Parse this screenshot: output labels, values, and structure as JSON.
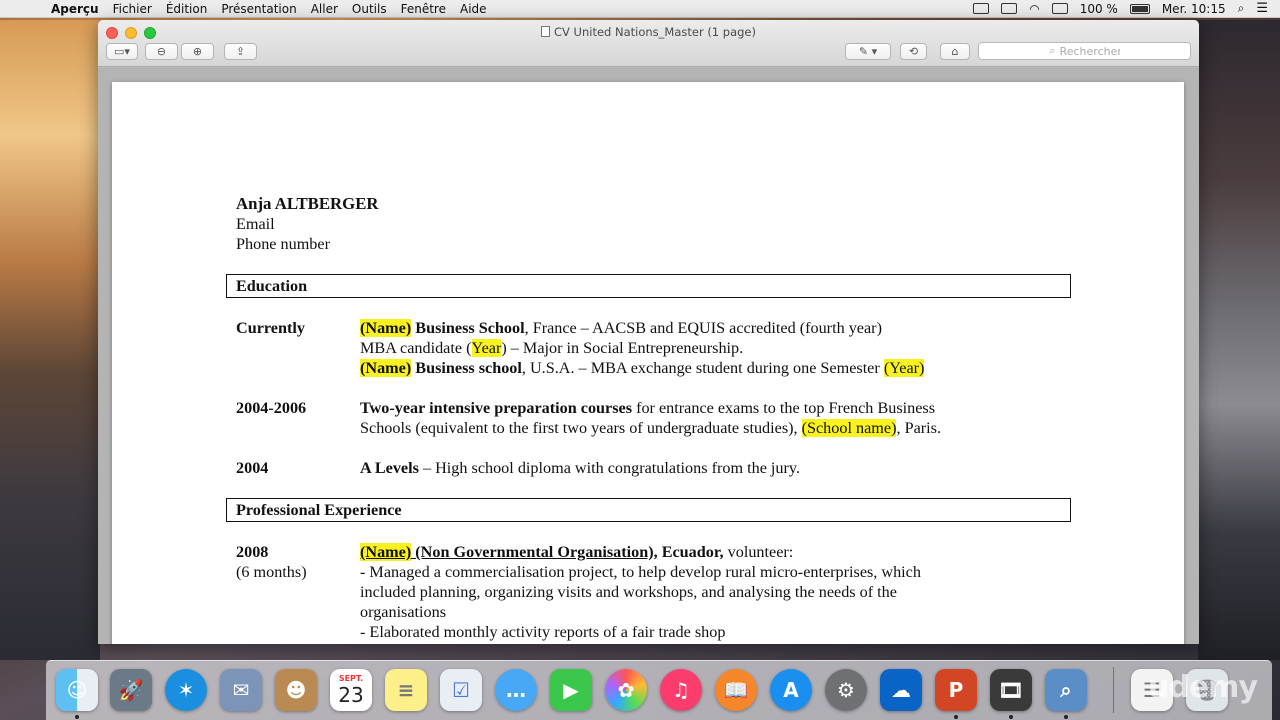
{
  "menubar": {
    "app_name": "Aperçu",
    "items": [
      "Fichier",
      "Édition",
      "Présentation",
      "Aller",
      "Outils",
      "Fenêtre",
      "Aide"
    ],
    "battery": "100 %",
    "clock": "Mer. 10:15"
  },
  "window": {
    "title": "CV United Nations_Master (1 page)",
    "search_placeholder": "Rechercher"
  },
  "cv": {
    "name": "Anja ALTBERGER",
    "email": "Email",
    "phone": "Phone number",
    "education_title": "Education",
    "education": [
      {
        "date": "Currently",
        "lines": [
          [
            {
              "t": "(Name)",
              "hl": true,
              "b": true
            },
            {
              "t": " Business School",
              "b": true
            },
            {
              "t": ", France – AACSB and EQUIS accredited (fourth year)"
            }
          ],
          [
            {
              "t": "MBA candidate ("
            },
            {
              "t": "Year",
              "hl": true
            },
            {
              "t": ") – Major in Social Entrepreneurship."
            }
          ],
          [
            {
              "t": "(Name)",
              "hl": true,
              "b": true
            },
            {
              "t": " Business school",
              "b": true
            },
            {
              "t": ", U.S.A. – MBA exchange student during one Semester "
            },
            {
              "t": "(Year)",
              "hl": true
            }
          ]
        ]
      },
      {
        "date": "2004-2006",
        "lines": [
          [
            {
              "t": "Two-year intensive preparation courses",
              "b": true
            },
            {
              "t": " for entrance exams to the top French Business"
            }
          ],
          [
            {
              "t": "Schools (equivalent to the first two years of undergraduate studies), "
            },
            {
              "t": "(School name)",
              "hl": true
            },
            {
              "t": ", Paris."
            }
          ]
        ]
      },
      {
        "date": "2004",
        "lines": [
          [
            {
              "t": "A Levels",
              "b": true
            },
            {
              "t": " – High school diploma with congratulations from the jury."
            }
          ]
        ]
      }
    ],
    "experience_title": "Professional Experience",
    "experience": [
      {
        "date": "2008",
        "subdate": "(6 months)",
        "lines": [
          [
            {
              "t": "(Name)",
              "hl": true,
              "b": true,
              "u": true
            },
            {
              "t": " (Non Governmental Organisation),",
              "b": true,
              "u": true
            },
            {
              "t": " Ecuador,",
              "b": true
            },
            {
              "t": " volunteer:"
            }
          ],
          [
            {
              "t": "- Managed a commercialisation project, to help develop rural micro-enterprises, which"
            }
          ],
          [
            {
              "t": "included planning, organizing visits and workshops, and analysing the needs of the"
            }
          ],
          [
            {
              "t": "organisations"
            }
          ],
          [
            {
              "t": " - Elaborated monthly activity reports of a fair trade shop"
            }
          ]
        ]
      }
    ]
  },
  "dock": {
    "calendar_month": "SEPT.",
    "calendar_day": "23",
    "watermark": "udemy"
  }
}
